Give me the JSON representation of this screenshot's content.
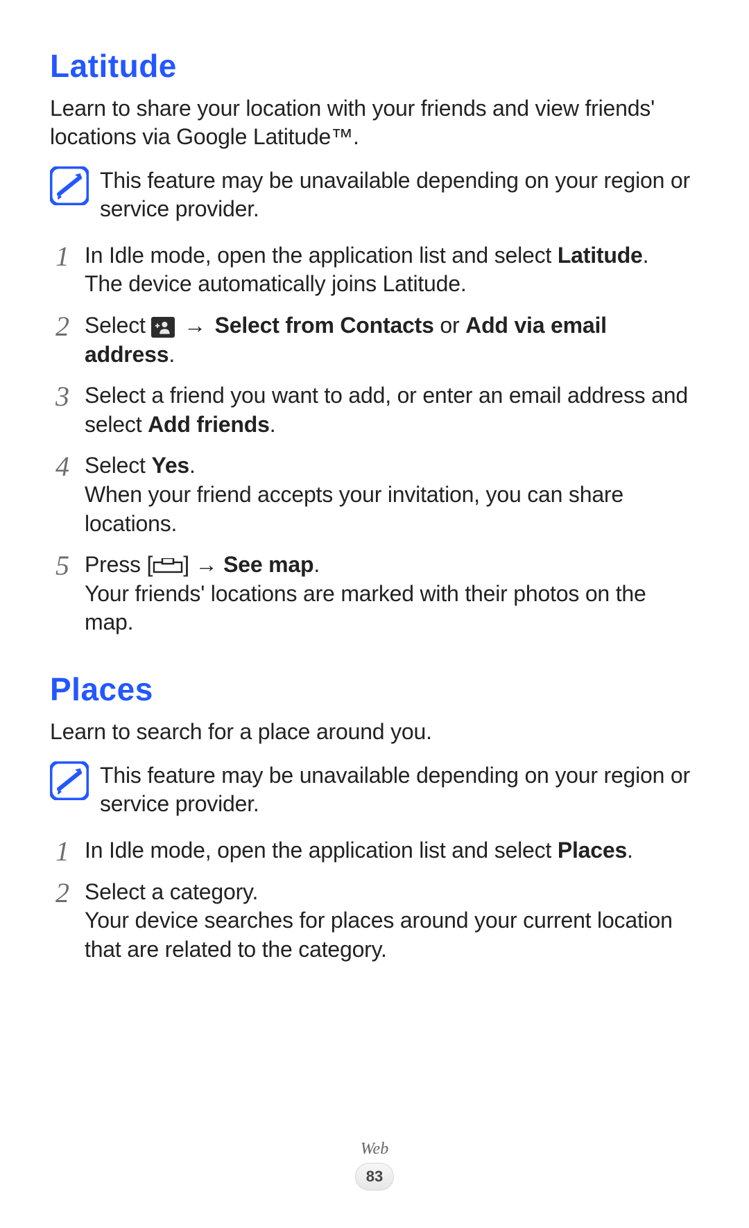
{
  "sections": {
    "latitude": {
      "title": "Latitude",
      "intro": "Learn to share your location with your friends and view friends' locations via Google Latitude™.",
      "note": "This feature may be unavailable depending on your region or service provider.",
      "steps": {
        "s1": {
          "num": "1",
          "body_pre": "In Idle mode, open the application list and select ",
          "bold1": "Latitude",
          "body_post": ".",
          "after": "The device automatically joins Latitude."
        },
        "s2": {
          "num": "2",
          "body_pre": "Select ",
          "arrow": " → ",
          "bold1": "Select from Contacts",
          "mid": " or ",
          "bold2": "Add via email address",
          "body_post": "."
        },
        "s3": {
          "num": "3",
          "body_pre": "Select a friend you want to add, or enter an email address and select ",
          "bold1": "Add friends",
          "body_post": "."
        },
        "s4": {
          "num": "4",
          "body_pre": "Select ",
          "bold1": "Yes",
          "body_post": ".",
          "after": "When your friend accepts your invitation, you can share locations."
        },
        "s5": {
          "num": "5",
          "body_pre": "Press [",
          "body_post": "] ",
          "arrow": "→ ",
          "bold1": "See map",
          "tail": ".",
          "after": "Your friends' locations are marked with their photos on the map."
        }
      }
    },
    "places": {
      "title": "Places",
      "intro": "Learn to search for a place around you.",
      "note": "This feature may be unavailable depending on your region or service provider.",
      "steps": {
        "s1": {
          "num": "1",
          "body_pre": "In Idle mode, open the application list and select ",
          "bold1": "Places",
          "body_post": "."
        },
        "s2": {
          "num": "2",
          "body_pre": "Select a category.",
          "after": "Your device searches for places around your current location that are related to the category."
        }
      }
    }
  },
  "footer": {
    "category": "Web",
    "page": "83"
  }
}
